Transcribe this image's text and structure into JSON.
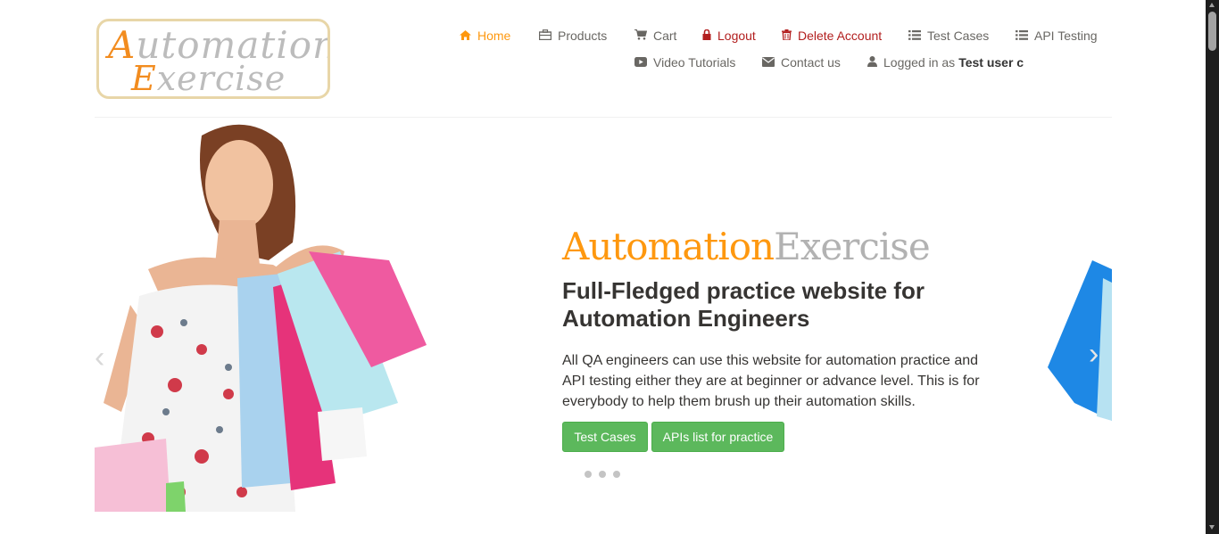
{
  "logo": {
    "first_cap": "A",
    "first_rest": "utomation",
    "second_cap": "E",
    "second_rest": "xercise"
  },
  "nav": {
    "home": "Home",
    "products": "Products",
    "cart": "Cart",
    "logout": "Logout",
    "delete_account": "Delete Account",
    "test_cases": "Test Cases",
    "api_testing": "API Testing",
    "video_tutorials": "Video Tutorials",
    "contact_us": "Contact us",
    "logged_in_prefix": "Logged in as",
    "logged_in_user": "Test user c"
  },
  "hero": {
    "brand_a": "Automation",
    "brand_b": "Exercise",
    "headline": "Full-Fledged practice website for Automation Engineers",
    "description": "All QA engineers can use this website for automation practice and API testing either they are at beginner or advance level. This is for everybody to help them brush up their automation skills.",
    "button_test_cases": "Test Cases",
    "button_apis": "APIs list for practice",
    "arrow_prev": "‹",
    "arrow_next": "›",
    "slide_count": 3
  },
  "colors": {
    "accent": "#fe980f",
    "danger": "#b21e1e",
    "button": "#5cb85c"
  }
}
